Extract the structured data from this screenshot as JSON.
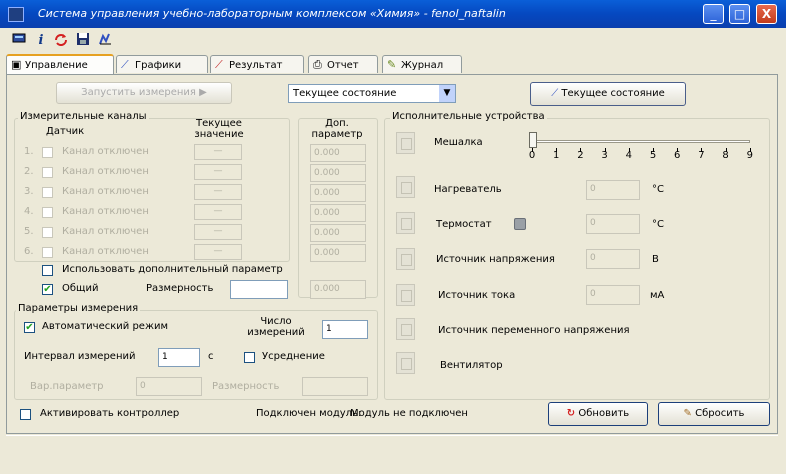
{
  "window": {
    "title": "Система управления учебно-лабораторным комплексом «Химия» - fenol_naftalin",
    "min_label": "_",
    "max_label": "□",
    "close_label": "X"
  },
  "toolbar": {
    "info_label": "i"
  },
  "tabs": [
    {
      "label": "Управление"
    },
    {
      "label": "Графики"
    },
    {
      "label": "Результат"
    },
    {
      "label": "Отчет"
    },
    {
      "label": "Журнал"
    }
  ],
  "top_controls": {
    "record_button": "Запустить измерения",
    "state_select": "Текущее состояние",
    "state_button": "Текущее состояние"
  },
  "measure_channels": {
    "title": "Измерительные каналы",
    "col_sensor": "Датчик",
    "col_current": "Текущее значение",
    "col_extra": "Доп. параметр",
    "rows": [
      {
        "num": "1.",
        "name": "Канал отключен",
        "current": "—",
        "extra": "0.000"
      },
      {
        "num": "2.",
        "name": "Канал отключен",
        "current": "—",
        "extra": "0.000"
      },
      {
        "num": "3.",
        "name": "Канал отключен",
        "current": "—",
        "extra": "0.000"
      },
      {
        "num": "4.",
        "name": "Канал отключен",
        "current": "—",
        "extra": "0.000"
      },
      {
        "num": "5.",
        "name": "Канал отключен",
        "current": "—",
        "extra": "0.000"
      },
      {
        "num": "6.",
        "name": "Канал отключен",
        "current": "—",
        "extra": "0.000"
      }
    ],
    "use_extra_label": "Использовать дополнительный параметр",
    "common_label": "Общий",
    "dimension_label": "Размерность",
    "dimension_value": "",
    "common_extra_value": "0.000"
  },
  "measure_params": {
    "title": "Параметры измерения",
    "auto_label": "Автоматический режим",
    "count_label": "Число измерений",
    "count_value": "1",
    "interval_label": "Интервал измерений",
    "interval_value": "1",
    "interval_unit": "с",
    "averaging_label": "Усреднение",
    "var_param_label": "Вар.параметр",
    "var_param_value": "0",
    "dimension2_label": "Размерность",
    "dimension2_value": ""
  },
  "devices": {
    "title": "Исполнительные устройства",
    "mixer_label": "Мешалка",
    "mixer_ticks": [
      "0",
      "1",
      "2",
      "3",
      "4",
      "5",
      "6",
      "7",
      "8",
      "9"
    ],
    "mixer_level": 0,
    "heater_label": "Нагреватель",
    "heater_value": "0",
    "heater_unit": "°C",
    "thermostat_label": "Термостат",
    "thermostat_value": "0",
    "thermostat_unit": "°C",
    "voltage_label": "Источник напряжения",
    "voltage_value": "0",
    "voltage_unit": "В",
    "current_label": "Источник тока",
    "current_value": "0",
    "current_unit": "мА",
    "ac_label": "Источник переменного напряжения",
    "fan_label": "Вентилятор"
  },
  "bottom": {
    "activate_label": "Активировать контроллер",
    "module_label": "Подключен модуль:",
    "module_value": "Модуль не подключен",
    "refresh_label": "Обновить",
    "reset_label": "Сбросить"
  },
  "colors": {
    "titlebar": "#0548c0",
    "check": "#21a121",
    "tab_accent": "#e6a121"
  }
}
